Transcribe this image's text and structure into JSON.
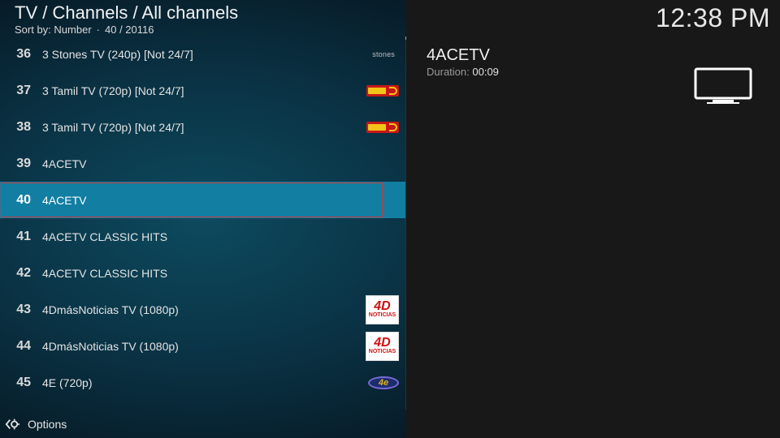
{
  "header": {
    "breadcrumb": "TV / Channels / All channels",
    "sort_label": "Sort by: Number",
    "separator": "·",
    "position": "40 / 20116"
  },
  "clock": "12:38 PM",
  "channels": [
    {
      "number": "36",
      "name": "3 Stones TV (240p) [Not 24/7]",
      "logo": "stones-logo",
      "logo_text": "stones"
    },
    {
      "number": "37",
      "name": "3 Tamil TV (720p) [Not 24/7]",
      "logo": "tamil-logo"
    },
    {
      "number": "38",
      "name": "3 Tamil TV (720p) [Not 24/7]",
      "logo": "tamil-logo"
    },
    {
      "number": "39",
      "name": "4ACETV",
      "logo": ""
    },
    {
      "number": "40",
      "name": "4ACETV",
      "logo": "",
      "selected": true
    },
    {
      "number": "41",
      "name": "4ACETV CLASSIC HITS",
      "logo": ""
    },
    {
      "number": "42",
      "name": "4ACETV CLASSIC HITS",
      "logo": ""
    },
    {
      "number": "43",
      "name": "4DmásNoticias TV (1080p)",
      "logo": "4dmas-logo",
      "logo_text_main": "4D",
      "logo_text_sub": "NOTICIAS"
    },
    {
      "number": "44",
      "name": "4DmásNoticias TV (1080p)",
      "logo": "4dmas-logo",
      "logo_text_main": "4D",
      "logo_text_sub": "NOTICIAS"
    },
    {
      "number": "45",
      "name": "4E (720p)",
      "logo": "4e-logo",
      "logo_text": "4e"
    }
  ],
  "footer": {
    "options_label": "Options",
    "icon": "gear-icon"
  },
  "detail": {
    "title": "4ACETV",
    "duration_label": "Duration:",
    "duration_value": "00:09",
    "icon": "tv-icon"
  },
  "colors": {
    "selected_row": "#127ea2",
    "focus_border": "#cc3a3a",
    "right_pane": "#181818"
  }
}
